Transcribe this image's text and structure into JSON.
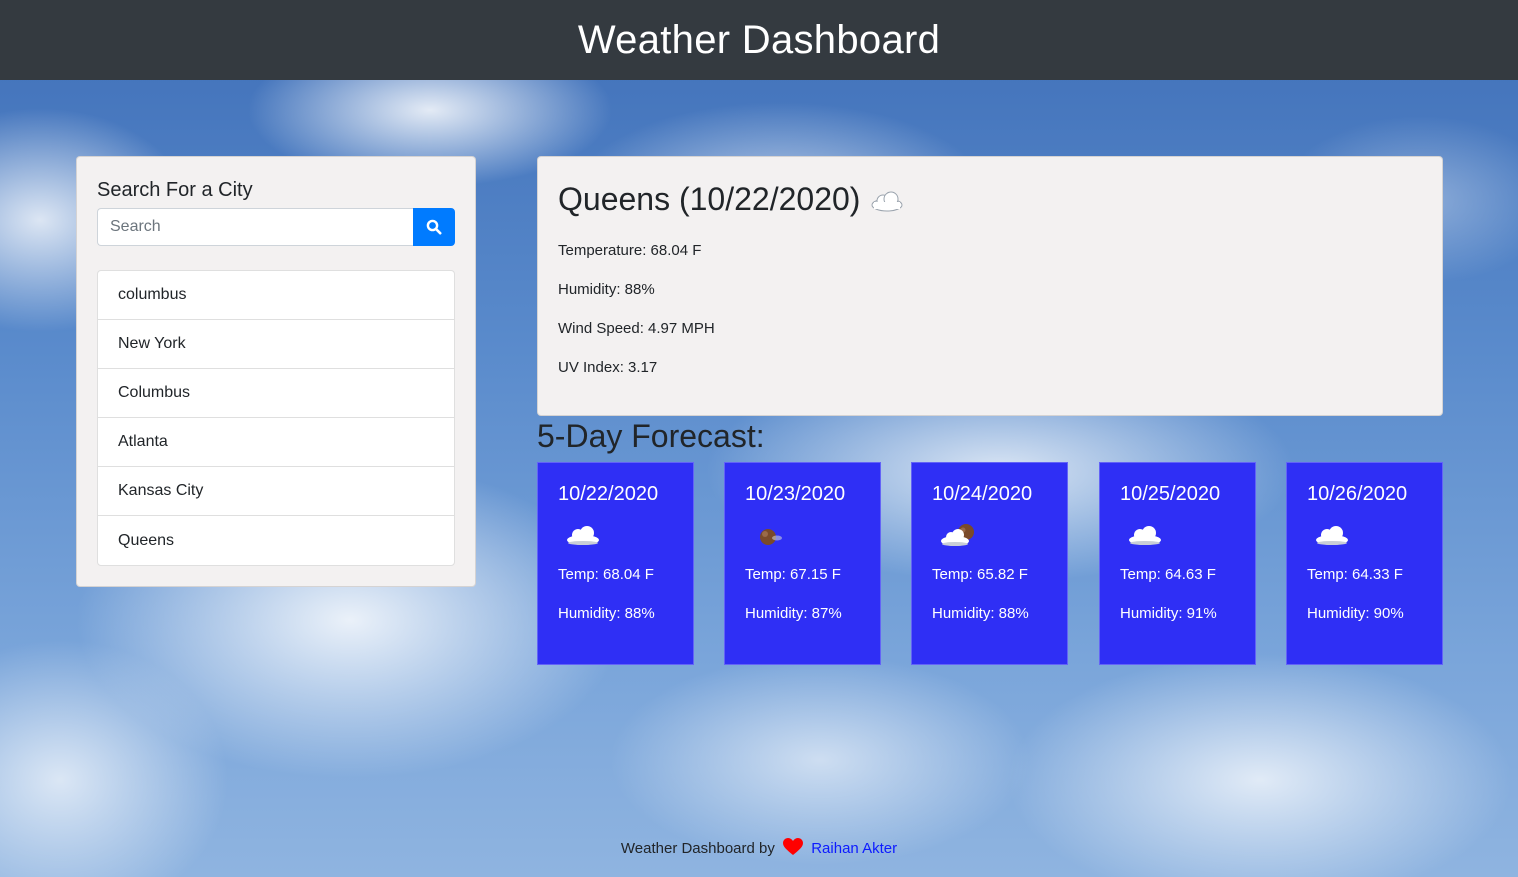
{
  "header": {
    "title": "Weather Dashboard"
  },
  "search": {
    "heading": "Search For a City",
    "placeholder": "Search",
    "button_icon": "search-icon",
    "history": [
      "columbus",
      "New York",
      "Columbus",
      "Atlanta",
      "Kansas City",
      "Queens"
    ]
  },
  "current": {
    "title": "Queens (10/22/2020)",
    "icon": "cloud-icon",
    "temperature": "Temperature: 68.04 F",
    "humidity": "Humidity: 88%",
    "wind": "Wind Speed: 4.97 MPH",
    "uv": "UV Index: 3.17"
  },
  "forecast": {
    "heading": "5-Day Forecast:",
    "days": [
      {
        "date": "10/22/2020",
        "icon": "cloud-icon",
        "temp": "Temp: 68.04 F",
        "humidity": "Humidity: 88%"
      },
      {
        "date": "10/23/2020",
        "icon": "cloud-night-icon",
        "temp": "Temp: 67.15 F",
        "humidity": "Humidity: 87%"
      },
      {
        "date": "10/24/2020",
        "icon": "cloud-moon-icon",
        "temp": "Temp: 65.82 F",
        "humidity": "Humidity: 88%"
      },
      {
        "date": "10/25/2020",
        "icon": "cloud-icon",
        "temp": "Temp: 64.63 F",
        "humidity": "Humidity: 91%"
      },
      {
        "date": "10/26/2020",
        "icon": "cloud-icon",
        "temp": "Temp: 64.33 F",
        "humidity": "Humidity: 90%"
      }
    ]
  },
  "footer": {
    "prefix": "Weather Dashboard by",
    "icon": "heart-icon",
    "author": "Raihan Akter"
  },
  "colors": {
    "navbar": "#343a40",
    "accent": "#007bff",
    "forecast_card": "#2f2ff5",
    "heart": "#ff0000",
    "link": "#0d1bff"
  }
}
